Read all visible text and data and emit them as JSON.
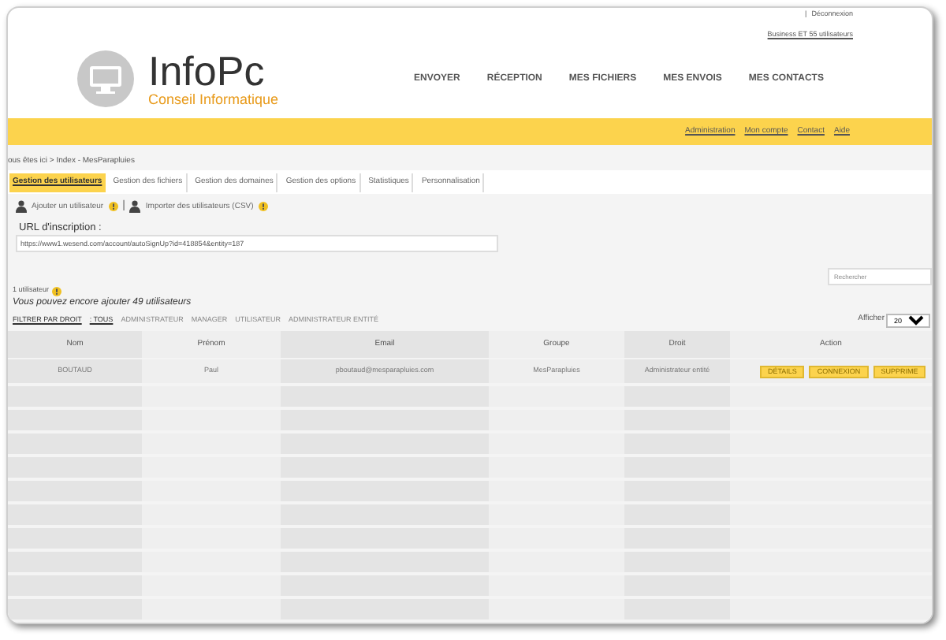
{
  "top_links": {
    "separator": "|",
    "logout": "Déconnexion",
    "plan": "Business ET 55 utilisateurs"
  },
  "logo": {
    "name": "InfoPc",
    "tagline": "Conseil Informatique"
  },
  "main_nav": [
    "ENVOYER",
    "RÉCEPTION",
    "MES FICHIERS",
    "MES ENVOIS",
    "MES CONTACTS"
  ],
  "sub_nav": [
    "Administration",
    "Mon compte",
    "Contact",
    "Aide"
  ],
  "breadcrumb": "ous êtes ici > Index - MesParapluies",
  "tabs": [
    {
      "label": "Gestion des utilisateurs",
      "selected": true
    },
    {
      "label": "Gestion des fichiers",
      "selected": false
    },
    {
      "label": "Gestion des domaines",
      "selected": false
    },
    {
      "label": "Gestion des options",
      "selected": false
    },
    {
      "label": "Statistiques",
      "selected": false
    },
    {
      "label": "Personnalisation",
      "selected": false
    }
  ],
  "actions": [
    {
      "label": "Ajouter un utilisateur"
    },
    {
      "label": "Importer des utilisateurs (CSV)"
    }
  ],
  "action_separator": "|",
  "url_field": {
    "label": "URL d'inscription :",
    "value": "https://www1.wesend.com/account/autoSignUp?id=418854&entity=187"
  },
  "search": {
    "placeholder": "Rechercher"
  },
  "count": "1 utilisateur",
  "remaining": "Vous pouvez encore ajouter 49 utilisateurs",
  "filter": {
    "label": "FILTRER PAR DROIT",
    "options": [
      {
        "label": ": TOUS",
        "selected": true
      },
      {
        "label": "ADMINISTRATEUR",
        "selected": false
      },
      {
        "label": "MANAGER",
        "selected": false
      },
      {
        "label": "UTILISATEUR",
        "selected": false
      },
      {
        "label": "ADMINISTRATEUR ENTITÉ",
        "selected": false
      }
    ]
  },
  "page_size": {
    "label": "Afficher",
    "value": "20"
  },
  "table": {
    "columns": [
      "Nom",
      "Prénom",
      "Email",
      "Groupe",
      "Droit",
      "Action"
    ],
    "rows": [
      {
        "cells": [
          "BOUTAUD",
          "Paul",
          "pboutaud@mesparapluies.com",
          "MesParapluies",
          "Administrateur entité"
        ],
        "actions": [
          "DÉTAILS",
          "CONNEXION",
          "SUPPRIME"
        ]
      }
    ]
  }
}
